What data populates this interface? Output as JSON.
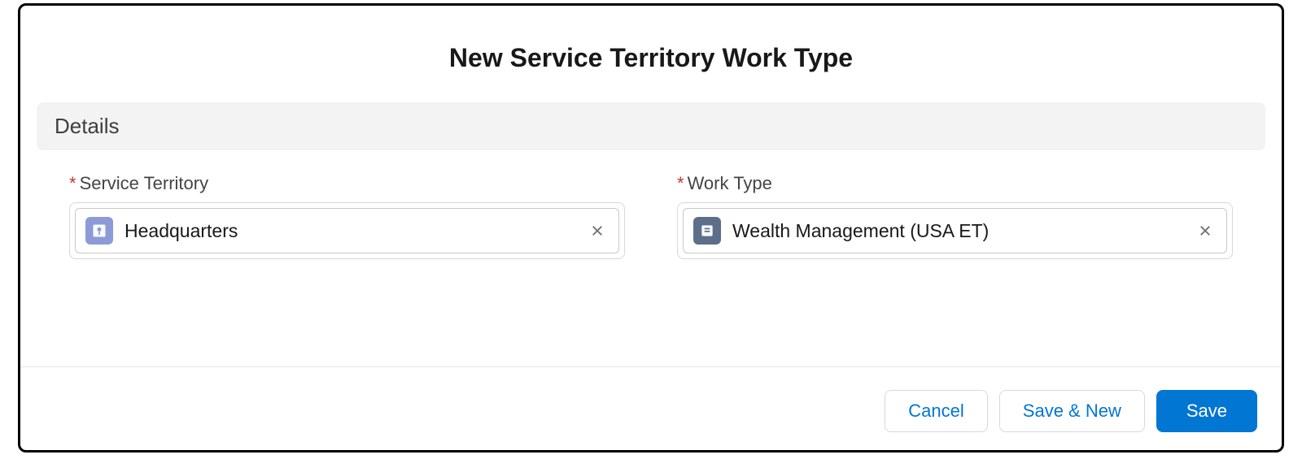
{
  "modal": {
    "title": "New Service Territory Work Type"
  },
  "section": {
    "header": "Details"
  },
  "fields": {
    "serviceTerritory": {
      "label": "Service Territory",
      "value": "Headquarters"
    },
    "workType": {
      "label": "Work Type",
      "value": "Wealth Management (USA ET)"
    }
  },
  "buttons": {
    "cancel": "Cancel",
    "saveNew": "Save & New",
    "save": "Save"
  }
}
